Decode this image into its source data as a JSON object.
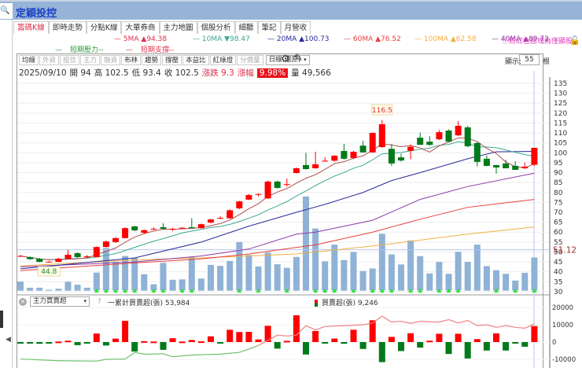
{
  "window": {
    "title": "定穎投控",
    "zoom_icon": "zoom-in-icon"
  },
  "tabs": [
    "籌碼K線",
    "即時走勢",
    "分點K線",
    "大單券商",
    "主力地圖",
    "個股分析",
    "細聽",
    "筆記",
    "月營收"
  ],
  "legend": {
    "ma5": {
      "label": "5MA",
      "arrow": "▲",
      "value": "94.38",
      "color": "#e0304a"
    },
    "ma10": {
      "label": "10MA",
      "arrow": "▼",
      "value": "98.47",
      "color": "#3aa890"
    },
    "ma20": {
      "label": "20MA",
      "arrow": "▲",
      "value": "100.73",
      "color": "#2a2a9a"
    },
    "ma60": {
      "label": "60MA",
      "arrow": "▲",
      "value": "76.52",
      "color": "#e84040"
    },
    "ma100": {
      "label": "100MA",
      "arrow": "▲",
      "value": "62.58",
      "color": "#f0b040"
    },
    "ma40": {
      "label": "40MA",
      "arrow": "▲",
      "value": "89.72",
      "color": "#8a3aa8"
    },
    "note": "ⓘ粉紅色區塊為僅顯股",
    "resistance": "短期壓力--",
    "support": "短期支撐--"
  },
  "toolbar": {
    "buttons": [
      {
        "label": "均線",
        "dim": false
      },
      {
        "label": "外資",
        "dim": true
      },
      {
        "label": "投信",
        "dim": true
      },
      {
        "label": "主力",
        "dim": true
      },
      {
        "label": "融資",
        "dim": true
      },
      {
        "label": "布林",
        "dim": false
      },
      {
        "label": "趨勢",
        "dim": false
      },
      {
        "label": "撐壓",
        "dim": false
      },
      {
        "label": "本益比",
        "dim": false
      },
      {
        "label": "紅綠燈",
        "dim": false
      },
      {
        "label": "分價量",
        "dim": true
      }
    ],
    "period": "日線(還原)",
    "show_label": "顯示:",
    "show_count": "55",
    "show_unit": "根"
  },
  "info": {
    "date": "2025/09/10",
    "open": "開 94",
    "high": "高 102.5",
    "low": "低 93.4",
    "close": "收 102.5",
    "change": "漲跌 9.3",
    "pct_label": "漲幅",
    "pct": "9.98%",
    "volume": "量 49,566"
  },
  "indicator": {
    "name": "主力買賣超",
    "help": "?",
    "cum_label": "一累計買賣超(張) 53,984",
    "bs_label": "買賣超(張) 9,246"
  },
  "colors": {
    "up": "#ff0000",
    "down": "#007a1a",
    "volume": "#8fb2d6"
  },
  "chart_data": {
    "type": "candlestick",
    "price_axis": {
      "min": 30,
      "max": 135,
      "ticks": [
        30,
        35,
        40,
        45,
        50,
        55,
        60,
        65,
        70,
        75,
        80,
        85,
        90,
        95,
        100,
        105,
        110,
        115,
        120,
        125,
        130,
        135
      ]
    },
    "annotations": {
      "high": "116.5",
      "low": "44.8",
      "volume_ref": "51.12"
    },
    "ohlc": [
      [
        48,
        48.5,
        47.5,
        48
      ],
      [
        47.4,
        47.8,
        46,
        46.4
      ],
      [
        46.6,
        47,
        44.8,
        45
      ],
      [
        45,
        45.5,
        44.8,
        45.1
      ],
      [
        45,
        47,
        44.9,
        46.6
      ],
      [
        46.6,
        51,
        46.4,
        48.6
      ],
      [
        49.4,
        49.8,
        47,
        47.4
      ],
      [
        47.6,
        48.5,
        47,
        47.8
      ],
      [
        47.4,
        52.8,
        47.2,
        52.5
      ],
      [
        52.5,
        55.8,
        52.3,
        55.3
      ],
      [
        55,
        57.5,
        54.6,
        57
      ],
      [
        57,
        62.5,
        56.8,
        62
      ],
      [
        62.9,
        63.2,
        60.5,
        60.9
      ],
      [
        59.7,
        61.3,
        59,
        61
      ],
      [
        61.7,
        62.4,
        61,
        61.7
      ],
      [
        62.5,
        64.4,
        61.5,
        61.7
      ],
      [
        61.7,
        62.2,
        60.6,
        61.7
      ],
      [
        61.8,
        62.6,
        61.5,
        62.2
      ],
      [
        62.5,
        67,
        62,
        62
      ],
      [
        62,
        64.3,
        61.8,
        64
      ],
      [
        64.8,
        66.8,
        64.5,
        66.4
      ],
      [
        67,
        68,
        66.5,
        67.2
      ],
      [
        67,
        71.6,
        66.8,
        71
      ],
      [
        72,
        75.8,
        71.6,
        75.5
      ],
      [
        76.4,
        79.2,
        76.2,
        78.7
      ],
      [
        79,
        79.6,
        78,
        79.2
      ],
      [
        77,
        86,
        76.8,
        85.5
      ],
      [
        85.5,
        86,
        82,
        82.3
      ],
      [
        84,
        87,
        83,
        84.2
      ],
      [
        89.8,
        92.6,
        89.6,
        92.2
      ],
      [
        93.8,
        100,
        91.5,
        91.8
      ],
      [
        92.2,
        100.5,
        92,
        94.2
      ],
      [
        96,
        97.8,
        95.5,
        96
      ],
      [
        96,
        98.8,
        95.6,
        98.5
      ],
      [
        100.9,
        104.5,
        96.6,
        97
      ],
      [
        97.4,
        101,
        96.8,
        100.5
      ],
      [
        103.6,
        106,
        100,
        100.2
      ],
      [
        100.2,
        110.2,
        100,
        110
      ],
      [
        102.9,
        116.5,
        102.5,
        114.4
      ],
      [
        102,
        104.4,
        93.4,
        94.6
      ],
      [
        97.7,
        99.6,
        95.5,
        96.1
      ],
      [
        101,
        104.2,
        96.8,
        103
      ],
      [
        107.6,
        110.2,
        104,
        104
      ],
      [
        105.6,
        108.4,
        103.5,
        104
      ],
      [
        106.8,
        111.5,
        106.4,
        110.4
      ],
      [
        111.2,
        111.8,
        105.6,
        105.6
      ],
      [
        108.8,
        116,
        108.4,
        113.6
      ],
      [
        112.8,
        113.5,
        102.8,
        103.3
      ],
      [
        104.9,
        105.5,
        93.2,
        95.4
      ],
      [
        97,
        98.6,
        93.2,
        93.4
      ],
      [
        93.8,
        94,
        89.5,
        92.6
      ],
      [
        94.6,
        96.5,
        92.2,
        92.2
      ],
      [
        93.4,
        95.8,
        91.4,
        91.4
      ],
      [
        92.2,
        95,
        91.8,
        93
      ],
      [
        94,
        102.5,
        93.4,
        102.5
      ]
    ],
    "volume_level": [
      35.1,
      32,
      32,
      31,
      31.5,
      35,
      33.5,
      32,
      39.6,
      52,
      45,
      48,
      47,
      38.8,
      33.7,
      44.5,
      36,
      36.2,
      47.5,
      36.6,
      43.5,
      43,
      45.5,
      55,
      48.5,
      42.7,
      49.7,
      43.8,
      42,
      47.5,
      78,
      61.8,
      45.3,
      53.7,
      45.9,
      50,
      40.4,
      41.7,
      59.2,
      48.8,
      43.7,
      55.8,
      47.9,
      39.2,
      45,
      39,
      50.1,
      45,
      53.7,
      42.9,
      40.8,
      39,
      35.6,
      39.5,
      47.2
    ],
    "signal_markers": [
      9,
      10,
      11,
      12,
      13,
      15,
      16,
      18,
      19,
      24,
      26,
      29,
      32,
      33,
      34,
      36,
      38,
      39,
      40,
      42,
      43,
      45,
      46,
      47,
      51,
      53,
      55
    ],
    "moving_averages": {
      "ma20": [
        [
          0,
          41.5
        ],
        [
          12,
          47
        ],
        [
          19,
          55
        ],
        [
          24,
          63
        ],
        [
          29,
          70
        ],
        [
          32,
          74
        ],
        [
          36,
          80
        ],
        [
          39,
          86
        ],
        [
          42,
          90
        ],
        [
          47,
          97
        ],
        [
          50,
          100.5
        ],
        [
          54,
          100.7
        ]
      ],
      "ma40": [
        [
          0,
          42.5
        ],
        [
          12,
          45
        ],
        [
          19,
          48
        ],
        [
          24,
          51.5
        ],
        [
          29,
          59
        ],
        [
          31,
          60
        ],
        [
          37,
          66
        ],
        [
          42,
          76.5
        ],
        [
          47,
          83
        ],
        [
          54,
          89.7
        ]
      ],
      "ma60": [
        [
          0,
          40.6
        ],
        [
          12,
          44.5
        ],
        [
          19,
          46.5
        ],
        [
          24,
          49
        ],
        [
          29,
          52.3
        ],
        [
          31,
          53.6
        ],
        [
          37,
          60
        ],
        [
          42,
          66.5
        ],
        [
          47,
          72.5
        ],
        [
          54,
          76.5
        ]
      ],
      "ma100": [
        [
          0,
          43
        ],
        [
          12,
          46
        ],
        [
          19,
          47
        ],
        [
          24,
          48
        ],
        [
          29,
          49
        ],
        [
          37,
          53
        ],
        [
          42,
          56
        ],
        [
          47,
          59
        ],
        [
          54,
          62.6
        ]
      ]
    },
    "indicator_axis": {
      "min": -13000,
      "max": 22000,
      "ticks": [
        -10000,
        0,
        10000,
        20000
      ]
    },
    "buy_sell": [
      -800,
      -800,
      -1000,
      -300,
      300,
      800,
      -1800,
      -800,
      4900,
      -2000,
      2000,
      12300,
      -5500,
      500,
      300,
      -4500,
      2200,
      300,
      1200,
      400,
      3300,
      -600,
      7100,
      5800,
      5900,
      1500,
      9400,
      -3800,
      700,
      15500,
      -7200,
      6400,
      -500,
      2000,
      -1000,
      7100,
      -4000,
      12600,
      -11600,
      3000,
      -5200,
      5100,
      -3200,
      800,
      4800,
      -6900,
      4800,
      -9500,
      1700,
      -4900,
      5000,
      -4900,
      -600,
      -2700,
      9246
    ],
    "cumulative_line": [
      [
        0,
        -9800
      ],
      [
        4,
        -10800
      ],
      [
        8,
        -11000
      ],
      [
        9,
        -10000
      ],
      [
        11,
        -9800
      ],
      [
        12,
        -6000
      ],
      [
        13,
        -7000
      ],
      [
        15,
        -6800
      ],
      [
        16,
        -8500
      ],
      [
        18,
        -7500
      ],
      [
        21,
        -7000
      ],
      [
        23,
        -6000
      ],
      [
        25,
        -2000
      ],
      [
        27,
        4000
      ],
      [
        28,
        3500
      ],
      [
        29,
        4000
      ],
      [
        30,
        9500
      ],
      [
        31,
        7000
      ],
      [
        32,
        9000
      ],
      [
        34,
        9500
      ],
      [
        36,
        10000
      ],
      [
        37,
        11000
      ],
      [
        38,
        15000
      ],
      [
        39,
        11500
      ],
      [
        40,
        12000
      ],
      [
        41,
        10800
      ],
      [
        42,
        12000
      ],
      [
        44,
        11500
      ],
      [
        45,
        13000
      ],
      [
        46,
        11000
      ],
      [
        47,
        12500
      ],
      [
        48,
        9500
      ],
      [
        49,
        10000
      ],
      [
        50,
        8500
      ],
      [
        51,
        9500
      ],
      [
        52,
        8500
      ],
      [
        53,
        8000
      ],
      [
        54,
        10500
      ]
    ]
  }
}
